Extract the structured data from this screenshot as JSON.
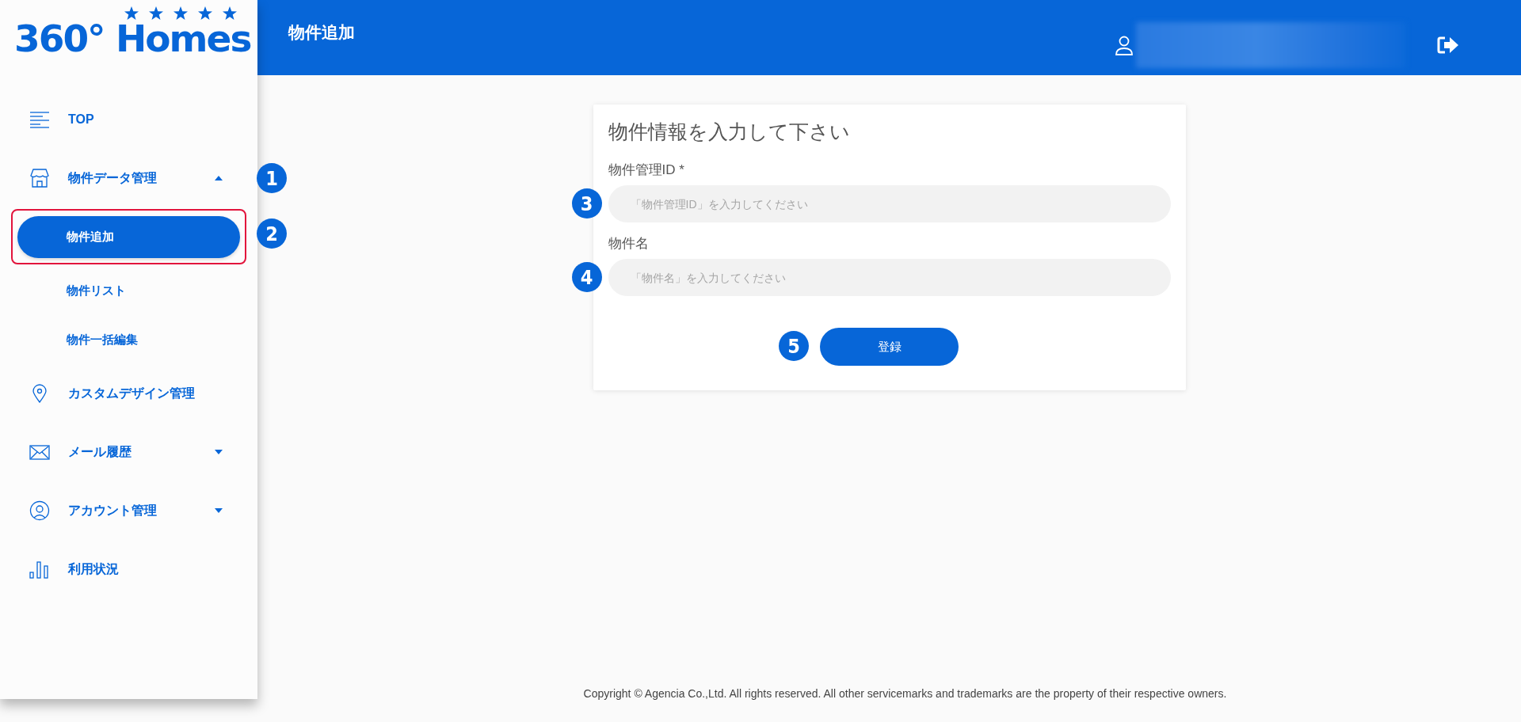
{
  "logo": {
    "text": "360° Homes"
  },
  "sidebar": {
    "items": [
      {
        "label": "TOP",
        "kind": "top"
      },
      {
        "label": "物件データ管理",
        "kind": "property",
        "expanded": true,
        "callout": "1",
        "children": [
          {
            "label": "物件追加",
            "selected": true,
            "highlighted": true,
            "callout": "2"
          },
          {
            "label": "物件リスト",
            "selected": false,
            "highlighted": false
          },
          {
            "label": "物件一括編集",
            "selected": false,
            "highlighted": false
          }
        ]
      },
      {
        "label": "カスタムデザイン管理",
        "kind": "design"
      },
      {
        "label": "メール履歴",
        "kind": "mail",
        "expanded": false
      },
      {
        "label": "アカウント管理",
        "kind": "account",
        "expanded": false
      },
      {
        "label": "利用状況",
        "kind": "usage"
      }
    ]
  },
  "header": {
    "title": "物件追加",
    "user_redacted": true
  },
  "form": {
    "title": "物件情報を入力して下さい",
    "fields": [
      {
        "label": "物件管理ID *",
        "placeholder": "「物件管理ID」を入力してください",
        "callout": "3"
      },
      {
        "label": "物件名",
        "placeholder": "「物件名」を入力してください",
        "callout": "4"
      }
    ],
    "submit": {
      "label": "登録",
      "callout": "5"
    }
  },
  "footer": "Copyright © Agencia Co.,Ltd. All rights reserved. All other servicemarks and trademarks are the property of their respective owners."
}
